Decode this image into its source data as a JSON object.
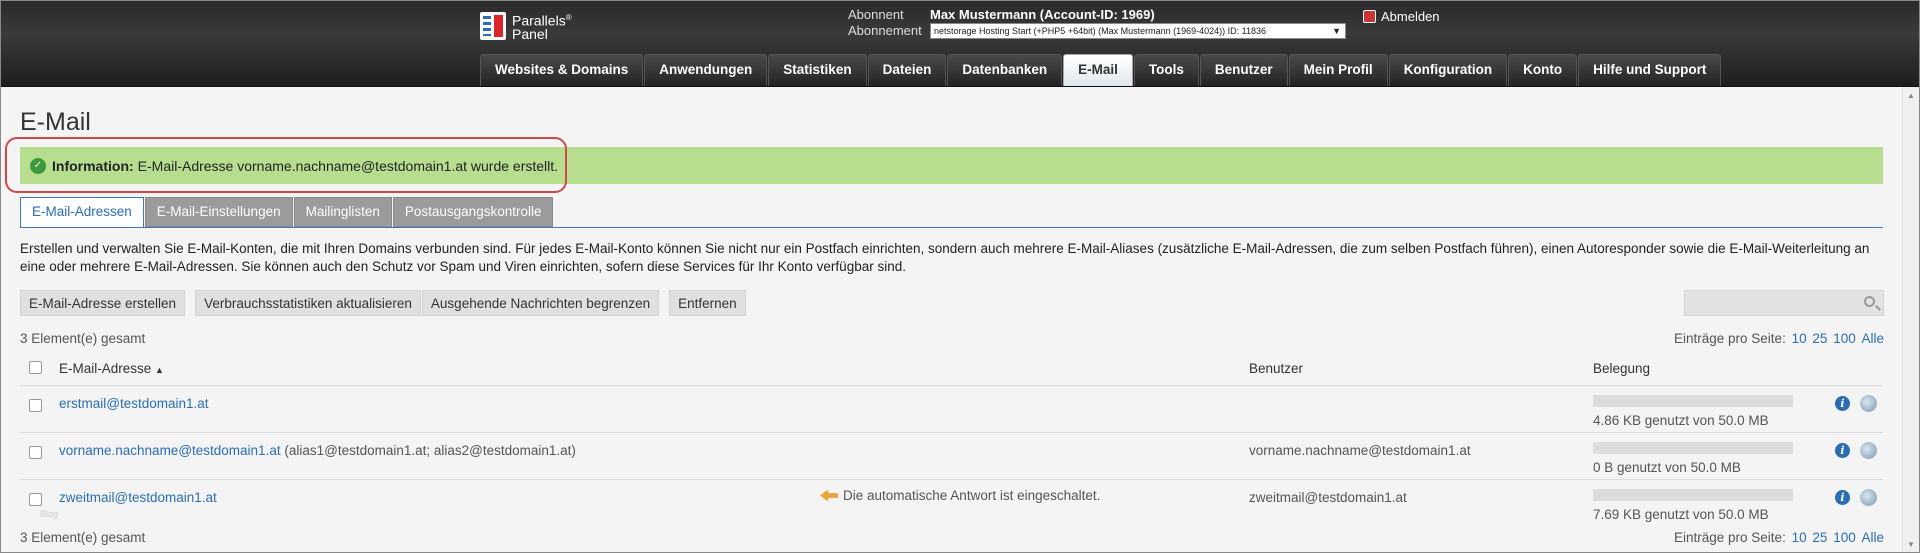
{
  "brand": {
    "line1": "Parallels",
    "reg": "®",
    "line2": "Panel"
  },
  "subscriber": {
    "label_subscriber": "Abonnent",
    "label_subscription": "Abonnement",
    "name": "Max Mustermann (Account-ID: 1969)",
    "subscription_value": "netstorage Hosting Start (+PHP5 +64bit) (Max Mustermann (1969-4024)) ID: 11836"
  },
  "logout_label": "Abmelden",
  "nav": [
    "Websites & Domains",
    "Anwendungen",
    "Statistiken",
    "Dateien",
    "Datenbanken",
    "E-Mail",
    "Tools",
    "Benutzer",
    "Mein Profil",
    "Konfiguration",
    "Konto",
    "Hilfe und Support"
  ],
  "nav_active": "E-Mail",
  "page_title": "E-Mail",
  "info": {
    "label": "Information:",
    "message": "E-Mail-Adresse vorname.nachname@testdomain1.at wurde erstellt."
  },
  "tabs": [
    "E-Mail-Adressen",
    "E-Mail-Einstellungen",
    "Mailinglisten",
    "Postausgangskontrolle"
  ],
  "description": "Erstellen und verwalten Sie E-Mail-Konten, die mit Ihren Domains verbunden sind. Für jedes E-Mail-Konto können Sie nicht nur ein Postfach einrichten, sondern auch mehrere E-Mail-Aliases (zusätzliche E-Mail-Adressen, die zum selben Postfach führen), einen Autoresponder sowie die E-Mail-Weiterleitung an eine oder mehrere E-Mail-Adressen. Sie können auch den Schutz vor Spam und Viren einrichten, sofern diese Services für Ihr Konto verfügbar sind.",
  "toolbar": {
    "create": "E-Mail-Adresse erstellen",
    "refresh": "Verbrauchsstatistiken aktualisieren",
    "limit": "Ausgehende Nachrichten begrenzen",
    "remove": "Entfernen"
  },
  "search": {
    "placeholder": ""
  },
  "total": "3 Element(e) gesamt",
  "per_page": {
    "label": "Einträge pro Seite:",
    "options": [
      "10",
      "25",
      "100",
      "Alle"
    ]
  },
  "columns": {
    "email": "E-Mail-Adresse",
    "sort_indicator": "▲",
    "user": "Benutzer",
    "usage": "Belegung"
  },
  "rows": [
    {
      "email": "erstmail@testdomain1.at",
      "alias": "",
      "autoresponder": "",
      "user": "",
      "usage": "4.86 KB genutzt von 50.0 MB",
      "usage_fraction": 0.0001
    },
    {
      "email": "vorname.nachname@testdomain1.at",
      "alias": "(alias1@testdomain1.at; alias2@testdomain1.at)",
      "autoresponder": "",
      "user": "vorname.nachname@testdomain1.at",
      "usage": "0 B genutzt von 50.0 MB",
      "usage_fraction": 0
    },
    {
      "email": "zweitmail@testdomain1.at",
      "alias": "",
      "autoresponder": "Die automatische Antwort ist eingeschaltet.",
      "user": "zweitmail@testdomain1.at",
      "usage": "7.69 KB genutzt von 50.0 MB",
      "usage_fraction": 0.0002
    }
  ],
  "row_watermark": "Blog",
  "colors": {
    "info_bg": "#b7de8f",
    "link": "#2a6db5",
    "highlight": "#d0474b"
  }
}
